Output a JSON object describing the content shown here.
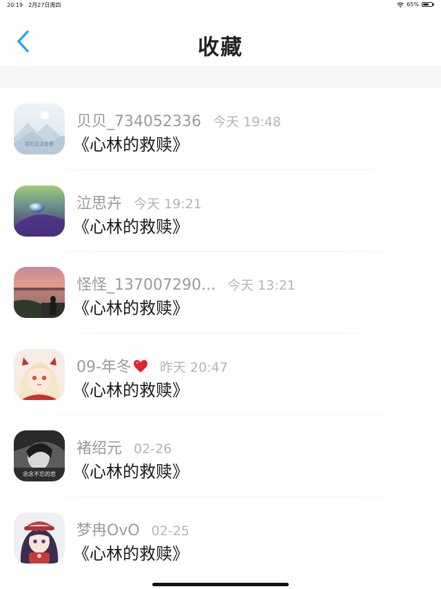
{
  "status_bar": {
    "time": "20:19",
    "date": "2月27日周四",
    "battery_text": "65%",
    "battery_level": 0.65
  },
  "header": {
    "title": "收藏",
    "back_icon": "chevron-left-icon",
    "accent_color": "#2a9df4"
  },
  "items": [
    {
      "name": "贝贝_734052336",
      "time": "今天 19:48",
      "title": "《心林的救赎》",
      "avatar": "placeholder",
      "avatar_caption": "暂时无法查看"
    },
    {
      "name": "泣思卉",
      "time": "今天 19:21",
      "title": "《心林的救赎》",
      "avatar": "water-drop"
    },
    {
      "name": "怪怪_137007290...",
      "time": "今天 13:21",
      "title": "《心林的救赎》",
      "avatar": "sunset-lake"
    },
    {
      "name": "09-年冬",
      "time": "昨天 20:47",
      "title": "《心林的救赎》",
      "avatar": "anime-girl",
      "badge_icon": "heart-icon"
    },
    {
      "name": "褚绍元",
      "time": "02-26",
      "title": "《心林的救赎》",
      "avatar": "bw-portrait",
      "avatar_caption": "念念不忘的恋"
    },
    {
      "name": "梦冉OvO",
      "time": "02-25",
      "title": "《心林的救赎》",
      "avatar": "anime-girl-beret"
    }
  ]
}
